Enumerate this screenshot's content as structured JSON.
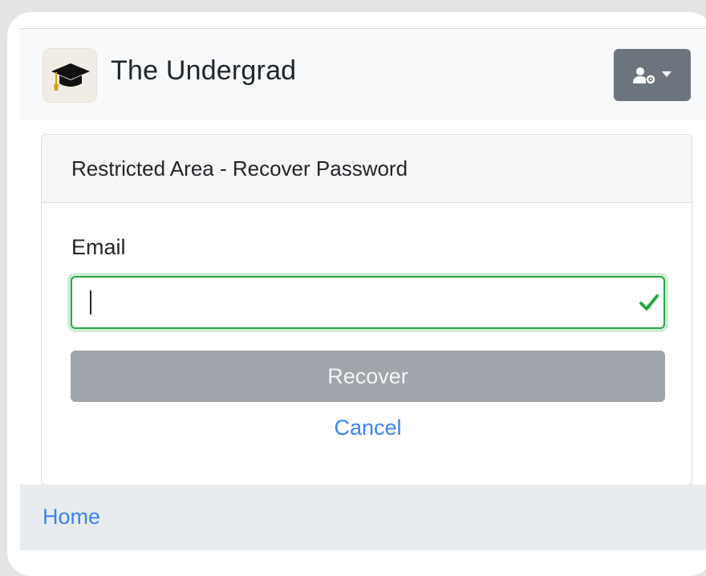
{
  "navbar": {
    "brand_name": "The Undergrad",
    "logo_icon": "graduation-cap-icon",
    "user_menu_icon": "user-gear-icon"
  },
  "card": {
    "header_title": "Restricted Area - Recover Password",
    "email_label": "Email",
    "email_value": "",
    "email_status": "valid",
    "recover_label": "Recover",
    "cancel_label": "Cancel"
  },
  "footer": {
    "home_label": "Home"
  },
  "colors": {
    "valid_green": "#28a745",
    "link_blue": "#3b82f6",
    "button_gray": "#a0a5ab",
    "menu_gray": "#6c757d"
  }
}
